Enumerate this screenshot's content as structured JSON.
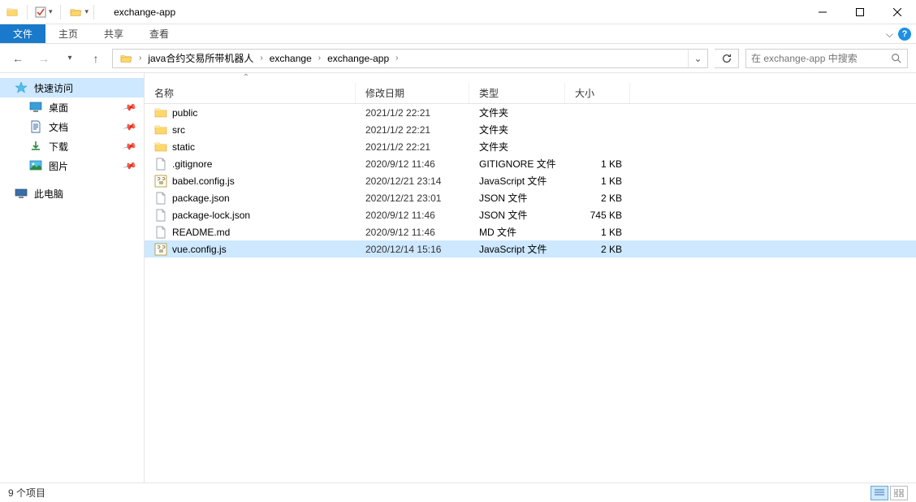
{
  "title": "exchange-app",
  "ribbon": {
    "file": "文件",
    "home": "主页",
    "share": "共享",
    "view": "查看"
  },
  "breadcrumb": [
    "java合约交易所带机器人",
    "exchange",
    "exchange-app"
  ],
  "search": {
    "placeholder": "在 exchange-app 中搜索"
  },
  "sidebar": {
    "quick": "快速访问",
    "items": [
      {
        "label": "桌面",
        "icon": "desktop",
        "pinned": true
      },
      {
        "label": "文档",
        "icon": "documents",
        "pinned": true
      },
      {
        "label": "下载",
        "icon": "downloads",
        "pinned": true
      },
      {
        "label": "图片",
        "icon": "pictures",
        "pinned": true
      }
    ],
    "thispc": "此电脑"
  },
  "columns": {
    "name": "名称",
    "modified": "修改日期",
    "type": "类型",
    "size": "大小"
  },
  "rows": [
    {
      "icon": "folder",
      "name": "public",
      "modified": "2021/1/2 22:21",
      "type": "文件夹",
      "size": ""
    },
    {
      "icon": "folder",
      "name": "src",
      "modified": "2021/1/2 22:21",
      "type": "文件夹",
      "size": ""
    },
    {
      "icon": "folder",
      "name": "static",
      "modified": "2021/1/2 22:21",
      "type": "文件夹",
      "size": ""
    },
    {
      "icon": "file",
      "name": ".gitignore",
      "modified": "2020/9/12 11:46",
      "type": "GITIGNORE 文件",
      "size": "1 KB"
    },
    {
      "icon": "js",
      "name": "babel.config.js",
      "modified": "2020/12/21 23:14",
      "type": "JavaScript 文件",
      "size": "1 KB"
    },
    {
      "icon": "file",
      "name": "package.json",
      "modified": "2020/12/21 23:01",
      "type": "JSON 文件",
      "size": "2 KB"
    },
    {
      "icon": "file",
      "name": "package-lock.json",
      "modified": "2020/9/12 11:46",
      "type": "JSON 文件",
      "size": "745 KB"
    },
    {
      "icon": "file",
      "name": "README.md",
      "modified": "2020/9/12 11:46",
      "type": "MD 文件",
      "size": "1 KB"
    },
    {
      "icon": "js",
      "name": "vue.config.js",
      "modified": "2020/12/14 15:16",
      "type": "JavaScript 文件",
      "size": "2 KB",
      "selected": true
    }
  ],
  "status": {
    "count": "9 个项目"
  }
}
